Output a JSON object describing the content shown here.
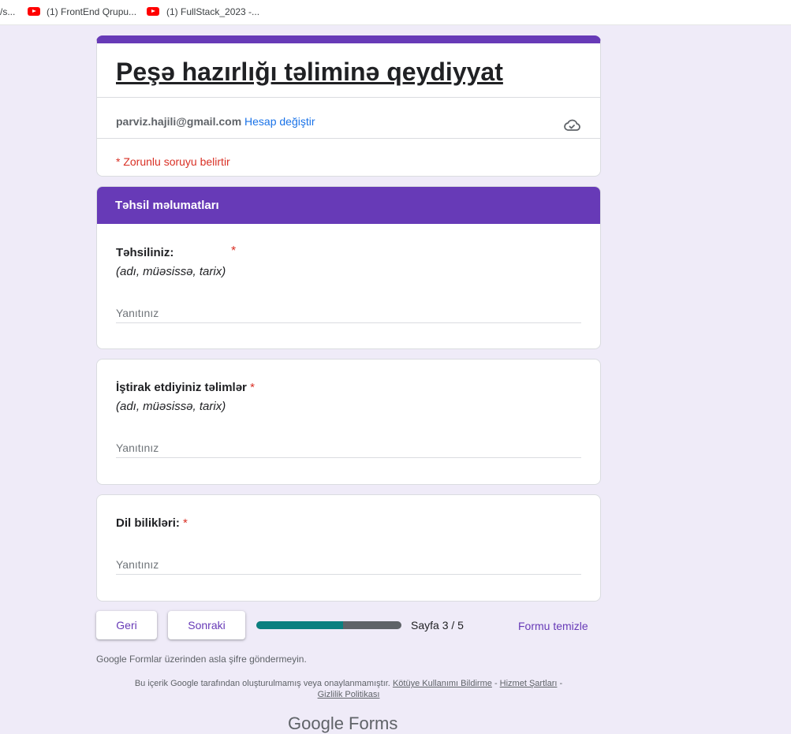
{
  "bookmarks": [
    {
      "label": "/s..."
    },
    {
      "label": "(1) FrontEnd Qrupu..."
    },
    {
      "label": "(1) FullStack_2023 -..."
    }
  ],
  "form": {
    "title": "Peşə hazırlığı təliminə qeydiyyat",
    "email": "parviz.hajili@gmail.com",
    "switch_account": "Hesap değiştir",
    "required_note": "* Zorunlu soruyu belirtir"
  },
  "section": {
    "title": "Təhsil məlumatları"
  },
  "questions": [
    {
      "title": "Təhsiliniz:",
      "required": "*",
      "hint": "(adı, müəsissə, tarix)",
      "placeholder": "Yanıtınız"
    },
    {
      "title": "İştirak etdiyiniz təlimlər",
      "required": "*",
      "hint": "(adı, müəsissə, tarix)",
      "placeholder": "Yanıtınız"
    },
    {
      "title": "Dil bilikləri:",
      "required": "*",
      "placeholder": "Yanıtınız"
    }
  ],
  "nav": {
    "back": "Geri",
    "next": "Sonraki",
    "page": "Sayfa 3 / 5",
    "progress": 0.6,
    "clear": "Formu temizle"
  },
  "footer": {
    "password_warning": "Google Formlar üzerinden asla şifre göndermeyin.",
    "disclaimer_text": "Bu içerik Google tarafından oluşturulmamış veya onaylanmamıştır.",
    "abuse_link": "Kötüye Kullanımı Bildirme",
    "terms_link": "Hizmet Şartları",
    "privacy_link": "Gizlilik Politikası",
    "logo": "Google Forms"
  },
  "colors": {
    "accent": "#673ab7",
    "background": "#efebf8",
    "progress_fill": "#0b8080",
    "required": "#d93025",
    "link": "#1a73e8"
  },
  "icons": [
    "youtube-icon",
    "cloud-check-icon"
  ]
}
